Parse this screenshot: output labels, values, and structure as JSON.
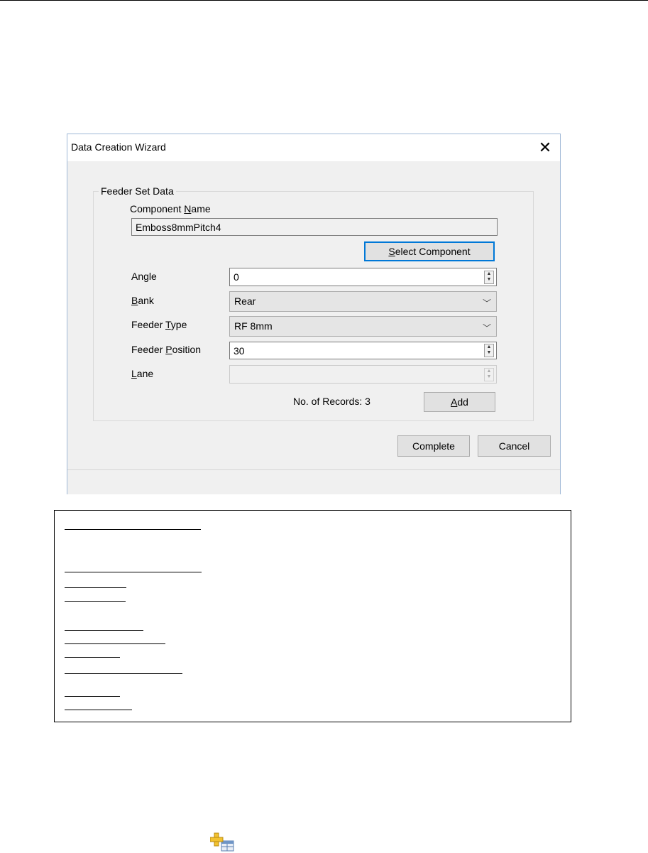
{
  "dialog": {
    "title": "Data Creation Wizard",
    "close_glyph": "✕",
    "group_title": "Feeder Set Data",
    "component_name": {
      "label_pre": "Component ",
      "label_key": "N",
      "label_post": "ame",
      "value": "Emboss8mmPitch4"
    },
    "select_button": {
      "pre": "",
      "key": "S",
      "post": "elect Component"
    },
    "angle": {
      "pre": "An",
      "key": "g",
      "post": "le",
      "value": "0"
    },
    "bank": {
      "pre": "",
      "key": "B",
      "post": "ank",
      "value": "Rear"
    },
    "feeder_type": {
      "pre": "Feeder ",
      "key": "T",
      "post": "ype",
      "value": "RF 8mm"
    },
    "feeder_position": {
      "pre": "Feeder ",
      "key": "P",
      "post": "osition",
      "value": "30"
    },
    "lane": {
      "pre": "",
      "key": "L",
      "post": "ane",
      "value": ""
    },
    "records_text": "No. of Records: 3",
    "add_button": {
      "pre": "",
      "key": "A",
      "post": "dd"
    },
    "complete_label": "Complete",
    "cancel_label": "Cancel"
  },
  "icons": {
    "bottom": "add-table-icon"
  }
}
